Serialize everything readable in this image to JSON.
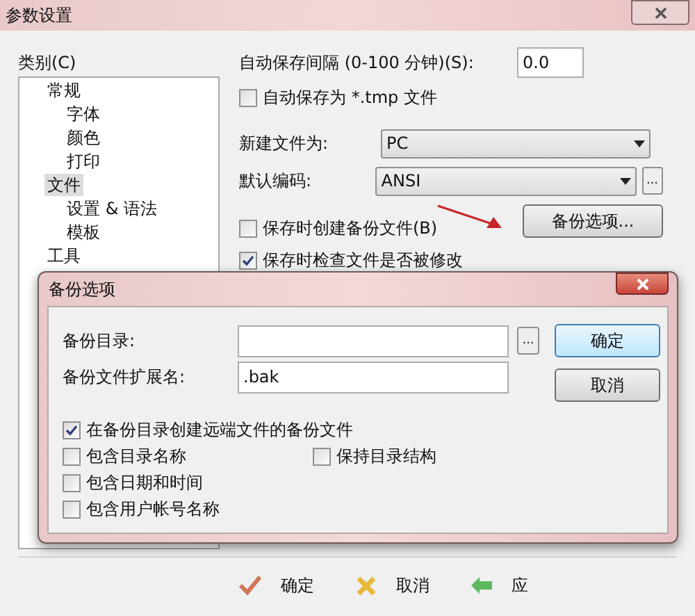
{
  "window": {
    "title": "参数设置"
  },
  "category_label": "类别(C)",
  "tree": [
    {
      "label": "常规",
      "selected": false,
      "children": [
        {
          "label": "字体",
          "selected": false
        },
        {
          "label": "颜色",
          "selected": false
        },
        {
          "label": "打印",
          "selected": false
        }
      ]
    },
    {
      "label": "文件",
      "selected": true,
      "children": [
        {
          "label": "设置 & 语法",
          "selected": false
        },
        {
          "label": "模板",
          "selected": false
        }
      ]
    },
    {
      "label": "工具",
      "selected": false
    }
  ],
  "autosave_interval": {
    "label": "自动保存间隔 (0-100 分钟)(S):",
    "value": "0.0"
  },
  "autosave_tmp": {
    "label": "自动保存为 *.tmp 文件",
    "checked": false
  },
  "new_file_as": {
    "label": "新建文件为:",
    "value": "PC"
  },
  "default_encoding": {
    "label": "默认编码:",
    "value": "ANSI",
    "browse": "..."
  },
  "backup_on_save": {
    "label": "保存时创建备份文件(B)",
    "checked": false
  },
  "backup_options_button": "备份选项...",
  "check_modified": {
    "label": "保存时检查文件是否被修改",
    "checked": true
  },
  "footer_buttons": [
    {
      "label": "确定",
      "kind": "ok"
    },
    {
      "label": "取消",
      "kind": "cancel"
    },
    {
      "label": "应",
      "kind": "apply"
    }
  ],
  "dialog": {
    "title": "备份选项",
    "backup_dir": {
      "label": "备份目录:",
      "browse": "..."
    },
    "extension": {
      "label": "备份文件扩展名:",
      "value": ".bak"
    },
    "buttons": [
      {
        "label": "确定",
        "kind": "default"
      },
      {
        "label": "取消",
        "kind": "normal"
      }
    ],
    "options": [
      {
        "label": "在备份目录创建远端文件的备份文件",
        "checked": true
      },
      {
        "label": "包含目录名称",
        "checked": false
      },
      {
        "label": "保持目录结构",
        "checked": false
      },
      {
        "label": "包含日期和时间",
        "checked": false
      },
      {
        "label": "包含用户帐号名称",
        "checked": false
      }
    ]
  }
}
